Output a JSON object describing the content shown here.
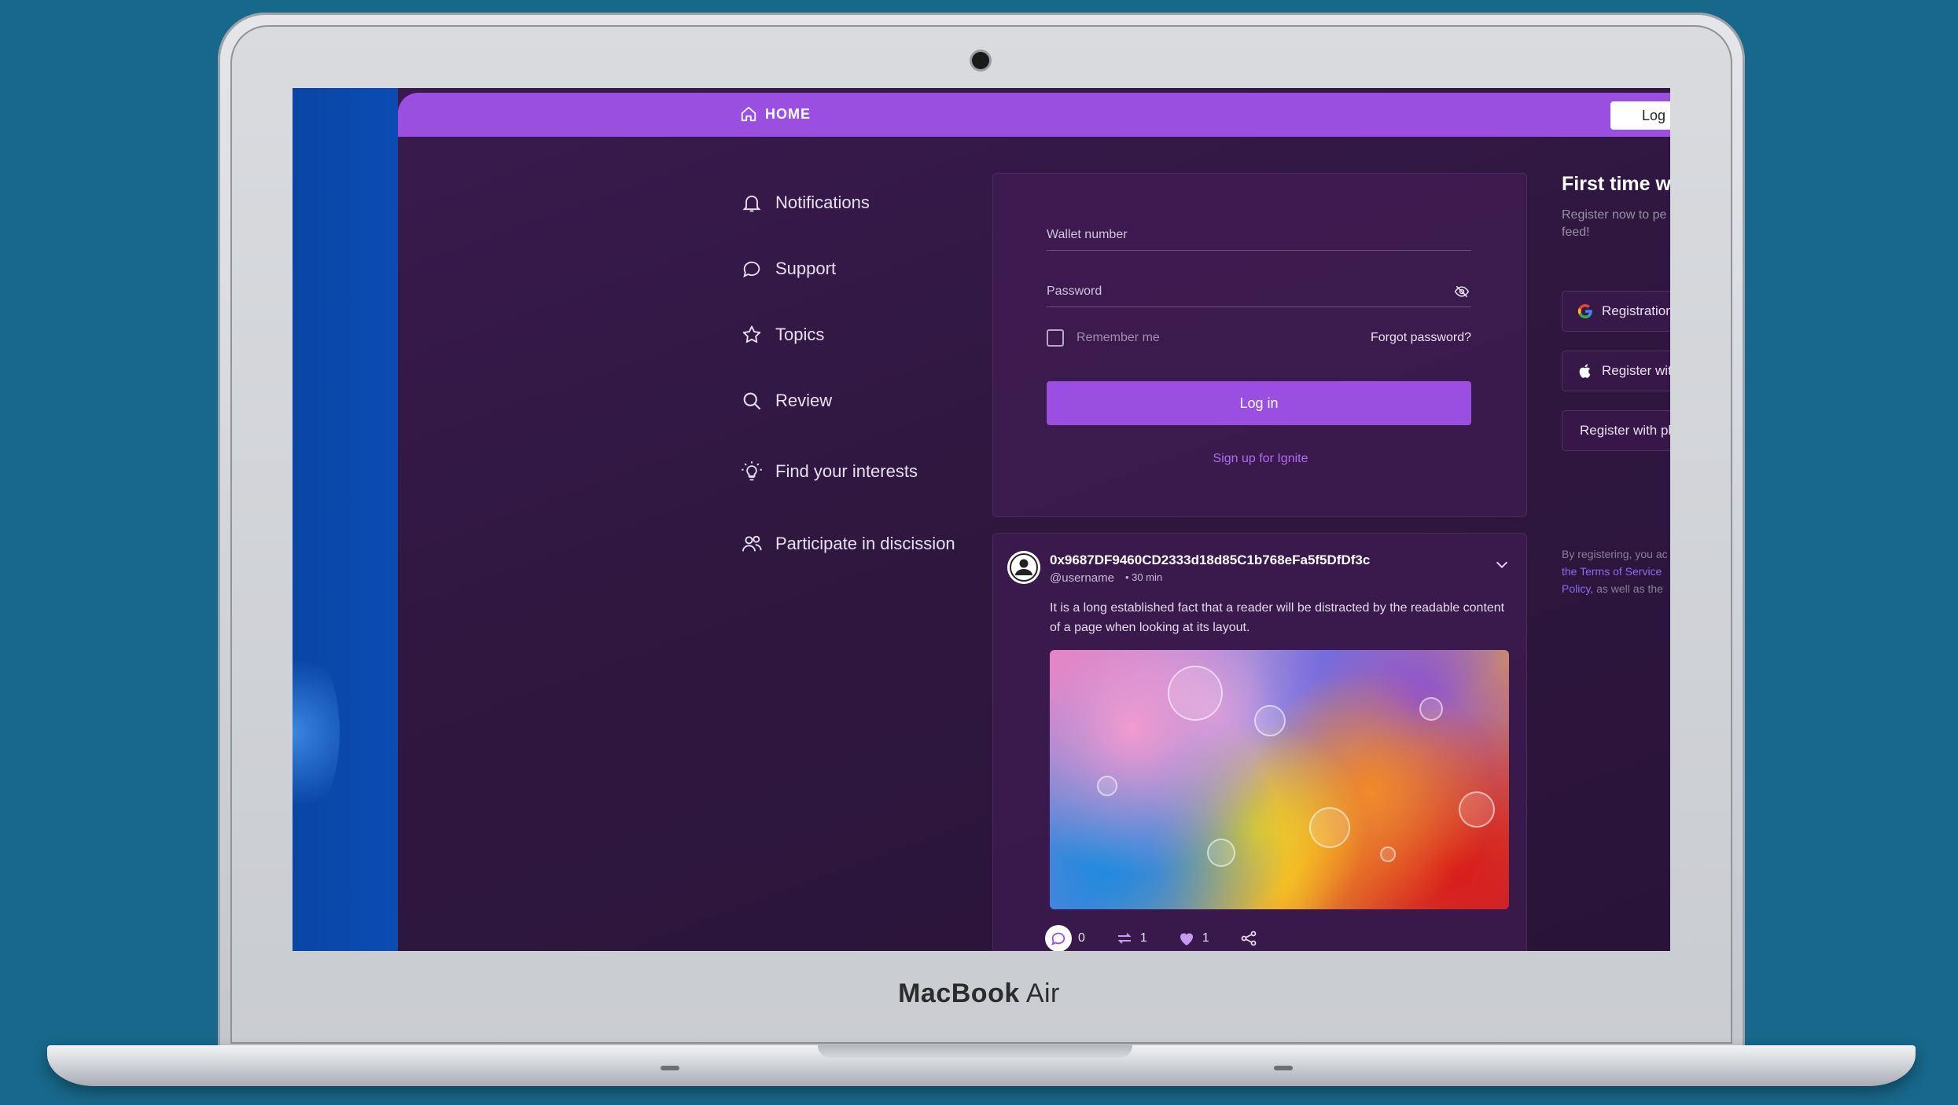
{
  "device": {
    "brand": "MacBook",
    "model": "Air"
  },
  "topbar": {
    "home_label": "HOME",
    "login_label": "Log"
  },
  "nav": {
    "items": [
      {
        "label": "Notifications",
        "icon": "bell-icon"
      },
      {
        "label": "Support",
        "icon": "chat-bubble-icon"
      },
      {
        "label": "Topics",
        "icon": "star-icon"
      },
      {
        "label": "Review",
        "icon": "search-icon"
      },
      {
        "label": "Find your interests",
        "icon": "lightbulb-icon"
      },
      {
        "label": "Participate in discission",
        "icon": "users-icon"
      }
    ]
  },
  "login": {
    "wallet_placeholder": "Wallet number",
    "password_placeholder": "Password",
    "remember_label": "Remember me",
    "forgot_label": "Forgot password?",
    "login_button": "Log in",
    "signup_link": "Sign up for Ignite"
  },
  "post": {
    "address": "0x9687DF9460CD2333d18d85C1b768eFa5f5DfDf3c",
    "username": "@username",
    "time": "• 30 min",
    "text": "It is a long established fact that a reader will be distracted by the readable content of a page when looking at its layout.",
    "comments": "0",
    "reposts": "1",
    "likes": "1"
  },
  "register_panel": {
    "title": "First time wi",
    "subtitle": "Register now to pe your feed!",
    "google_button": "Registration",
    "apple_button": "Register with",
    "phone_button": "Register with ph",
    "legal_prefix": "By registering, you ac",
    "legal_terms": "the Terms of Service",
    "legal_policy": "Policy,",
    "legal_suffix": "as well as the"
  },
  "colors": {
    "accent": "#9b4fe0",
    "background": "#17688a",
    "app_bg": "#2f1740",
    "link": "#b06cf0"
  }
}
